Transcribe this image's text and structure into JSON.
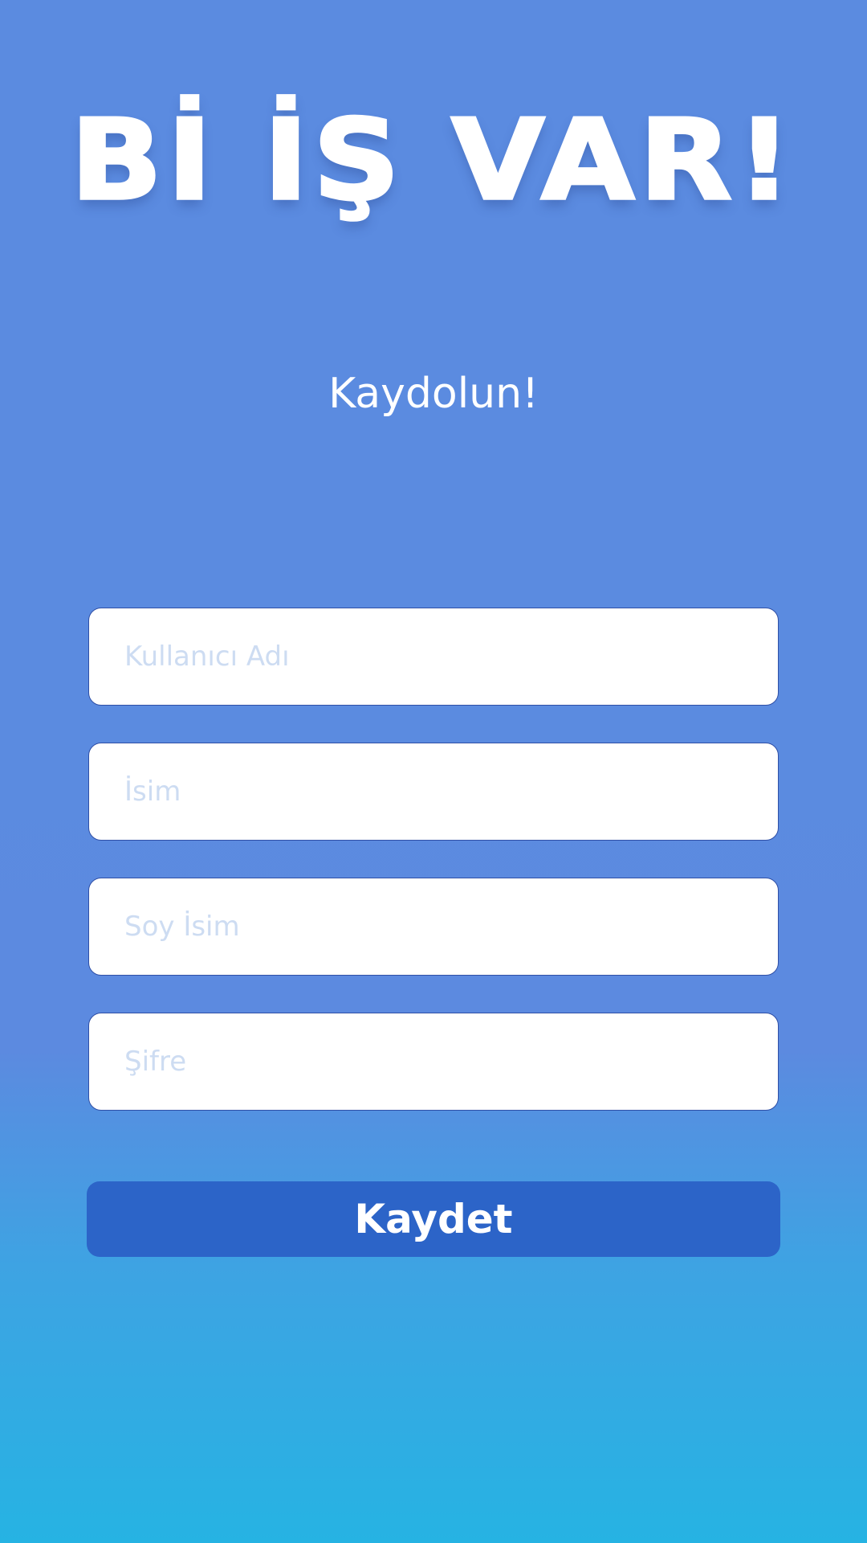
{
  "app": {
    "title": "Bİ İŞ VAR!",
    "subtitle": "Kaydolun!"
  },
  "form": {
    "username_placeholder": "Kullanıcı Adı",
    "name_placeholder": "İsim",
    "surname_placeholder": "Soy İsim",
    "password_placeholder": "Şifre",
    "submit_label": "Kaydet"
  },
  "colors": {
    "background_top": "#5b8be0",
    "background_bottom": "#26b3e3",
    "button": "#2c64c8",
    "field_border": "#2f4fa6",
    "placeholder": "#cddcf2"
  }
}
